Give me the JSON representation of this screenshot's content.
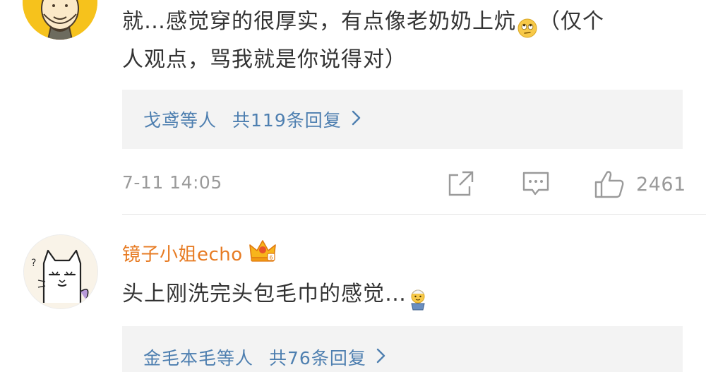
{
  "comment1": {
    "text_line1": "就…感觉穿的很厚实，有点像老奶奶上炕",
    "text_line1_tail": "（仅个",
    "text_line2": "人观点，骂我就是你说得对）",
    "emoji_icon": "rolling-eyes-emoji-icon",
    "replies": {
      "users": "戈鸢等人",
      "count_text": "共119条回复"
    },
    "timestamp": "7-11 14:05",
    "like_count": "2461"
  },
  "comment2": {
    "username": "镜子小姐echo",
    "badge_icon": "vip-crown-icon",
    "text": "头上刚洗完头包毛巾的感觉…",
    "emoji_icon": "towel-head-emoji-icon",
    "replies": {
      "users": "金毛本毛等人",
      "count_text": "共76条回复"
    }
  },
  "colors": {
    "link_blue": "#4e7fb0",
    "username_orange": "#e77b23",
    "meta_gray": "#9a9a9a",
    "reply_bg": "#f3f3f3",
    "avatar1_bg": "#f6c21c"
  }
}
